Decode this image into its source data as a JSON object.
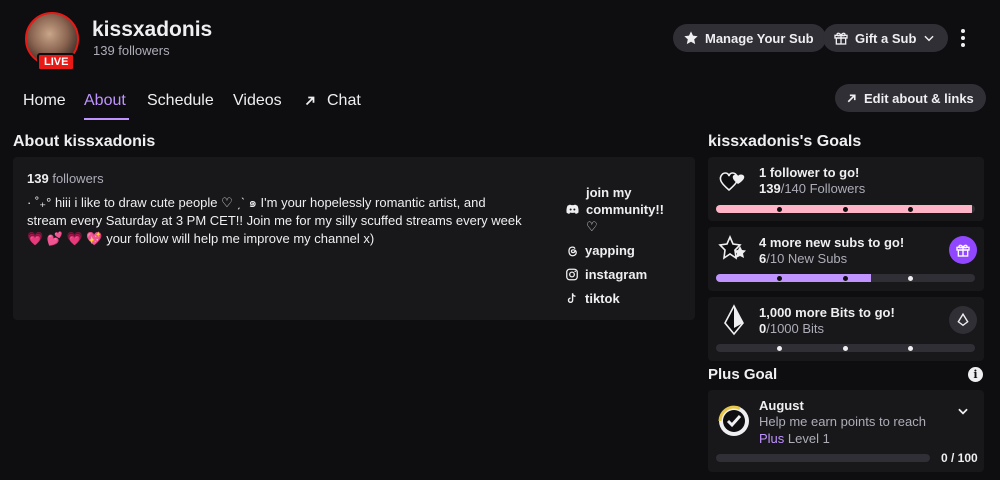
{
  "channel": {
    "name": "kissxadonis",
    "followers_label": "139 followers",
    "live_badge": "LIVE"
  },
  "header_buttons": {
    "manage_sub": "Manage Your Sub",
    "gift_sub": "Gift a Sub"
  },
  "tabs": [
    {
      "label": "Home"
    },
    {
      "label": "About",
      "active": true
    },
    {
      "label": "Schedule"
    },
    {
      "label": "Videos"
    },
    {
      "label": "Chat"
    }
  ],
  "edit_button": "Edit about & links",
  "about": {
    "title": "About kissxadonis",
    "follower_count": "139",
    "follower_word": "followers",
    "bio": "· ˚₊° hiii i like to draw cute people ♡ ˏˋ ๑ I'm your hopelessly romantic artist, and stream every Saturday at 3 PM CET!! Join me for my silly scuffed streams every week 💗 💕 💗 💖 your follow will help me improve my channel x)",
    "links": [
      {
        "label": "join my community!! ♡",
        "icon": "discord-icon"
      },
      {
        "label": "yapping",
        "icon": "threads-icon"
      },
      {
        "label": "instagram",
        "icon": "instagram-icon"
      },
      {
        "label": "tiktok",
        "icon": "tiktok-icon"
      }
    ]
  },
  "goals": {
    "title": "kissxadonis's Goals",
    "items": [
      {
        "headline": "1 follower to go!",
        "current": "139",
        "rest": "/140 Followers",
        "progress": 0.99,
        "color": "#ffb3c6",
        "icon": "hearts-icon"
      },
      {
        "headline": "4 more new subs to go!",
        "current": "6",
        "rest": "/10 New Subs",
        "progress": 0.6,
        "color": "#bf94ff",
        "icon": "stars-icon",
        "action_icon": "gift-icon"
      },
      {
        "headline": "1,000 more Bits to go!",
        "current": "0",
        "rest": "/1000 Bits",
        "progress": 0.0,
        "color": "#2f2f35",
        "icon": "bits-icon",
        "action_icon": "bits-icon"
      }
    ]
  },
  "plus_goal": {
    "title": "Plus Goal",
    "month": "August",
    "description": "Help me earn points to reach",
    "plus_word": "Plus",
    "level": "Level 1",
    "count": "0 / 100",
    "progress": 0.0
  },
  "colors": {
    "accent": "#bf94ff",
    "live": "#e91916",
    "background": "#0e0e10",
    "panel": "#18181b"
  }
}
